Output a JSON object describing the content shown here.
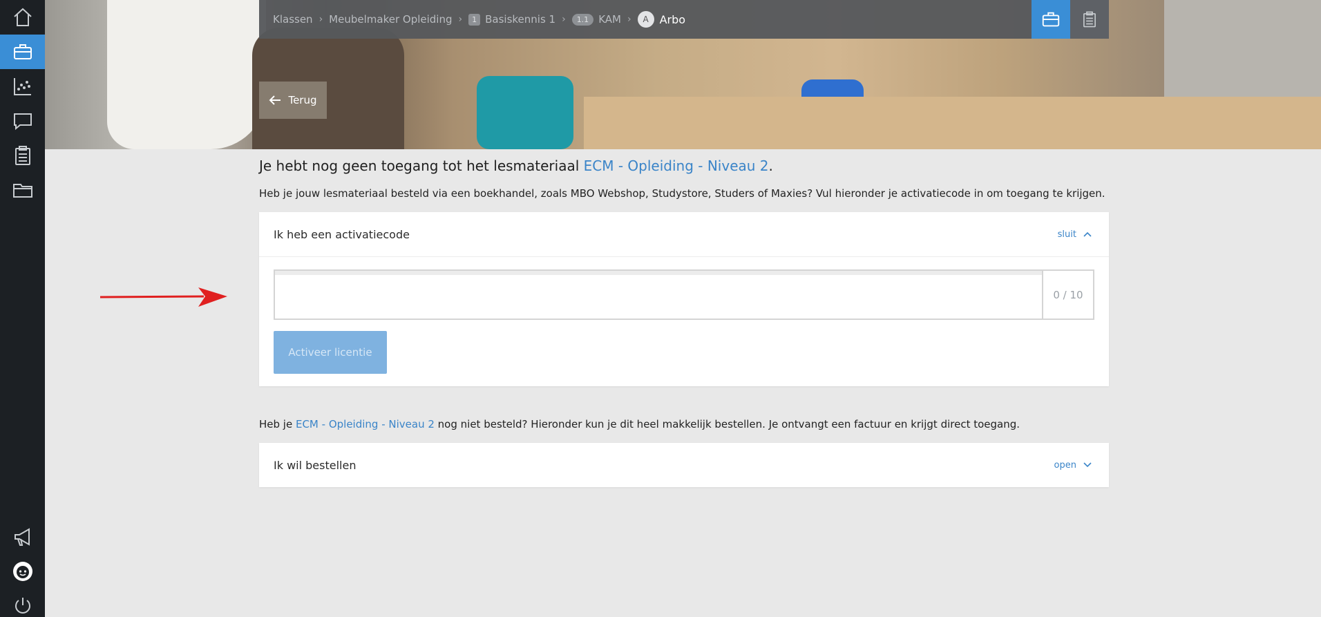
{
  "sidebar": {
    "items": [
      {
        "name": "home-icon"
      },
      {
        "name": "briefcase-icon",
        "active": true
      },
      {
        "name": "chart-icon"
      },
      {
        "name": "chat-icon"
      },
      {
        "name": "clipboard-icon"
      },
      {
        "name": "folder-icon"
      },
      {
        "name": "megaphone-icon"
      },
      {
        "name": "avatar-icon"
      },
      {
        "name": "power-icon"
      }
    ],
    "accent": "#3a8ed6",
    "background": "#1c2024"
  },
  "breadcrumb": {
    "items": [
      {
        "label": "Klassen"
      },
      {
        "label": "Meubelmaker Opleiding"
      },
      {
        "badge": "1",
        "label": "Basiskennis 1"
      },
      {
        "badge": "1.1",
        "label": "KAM"
      }
    ],
    "current": {
      "badge": "A",
      "label": "Arbo"
    }
  },
  "back_button": {
    "label": "Terug"
  },
  "headline": {
    "prefix": "Je hebt nog geen toegang tot het lesmateriaal",
    "link": "ECM - Opleiding - Niveau 2",
    "suffix": "."
  },
  "intro": "Heb je jouw lesmateriaal besteld via een boekhandel, zoals MBO Webshop, Studystore, Studers of Maxies? Vul hieronder je activatiecode in om toegang te krijgen.",
  "activation_panel": {
    "title": "Ik heb een activatiecode",
    "toggle": "sluit",
    "input_value": "",
    "counter": "0 / 10",
    "button": "Activeer licentie"
  },
  "order_text": {
    "prefix": "Heb je",
    "link": "ECM - Opleiding - Niveau 2",
    "suffix": "nog niet besteld? Hieronder kun je dit heel makkelijk bestellen. Je ontvangt een factuur en krijgt direct toegang."
  },
  "order_panel": {
    "title": "Ik wil bestellen",
    "toggle": "open"
  },
  "colors": {
    "link": "#3a84c8",
    "annotation_arrow": "#e02020"
  }
}
